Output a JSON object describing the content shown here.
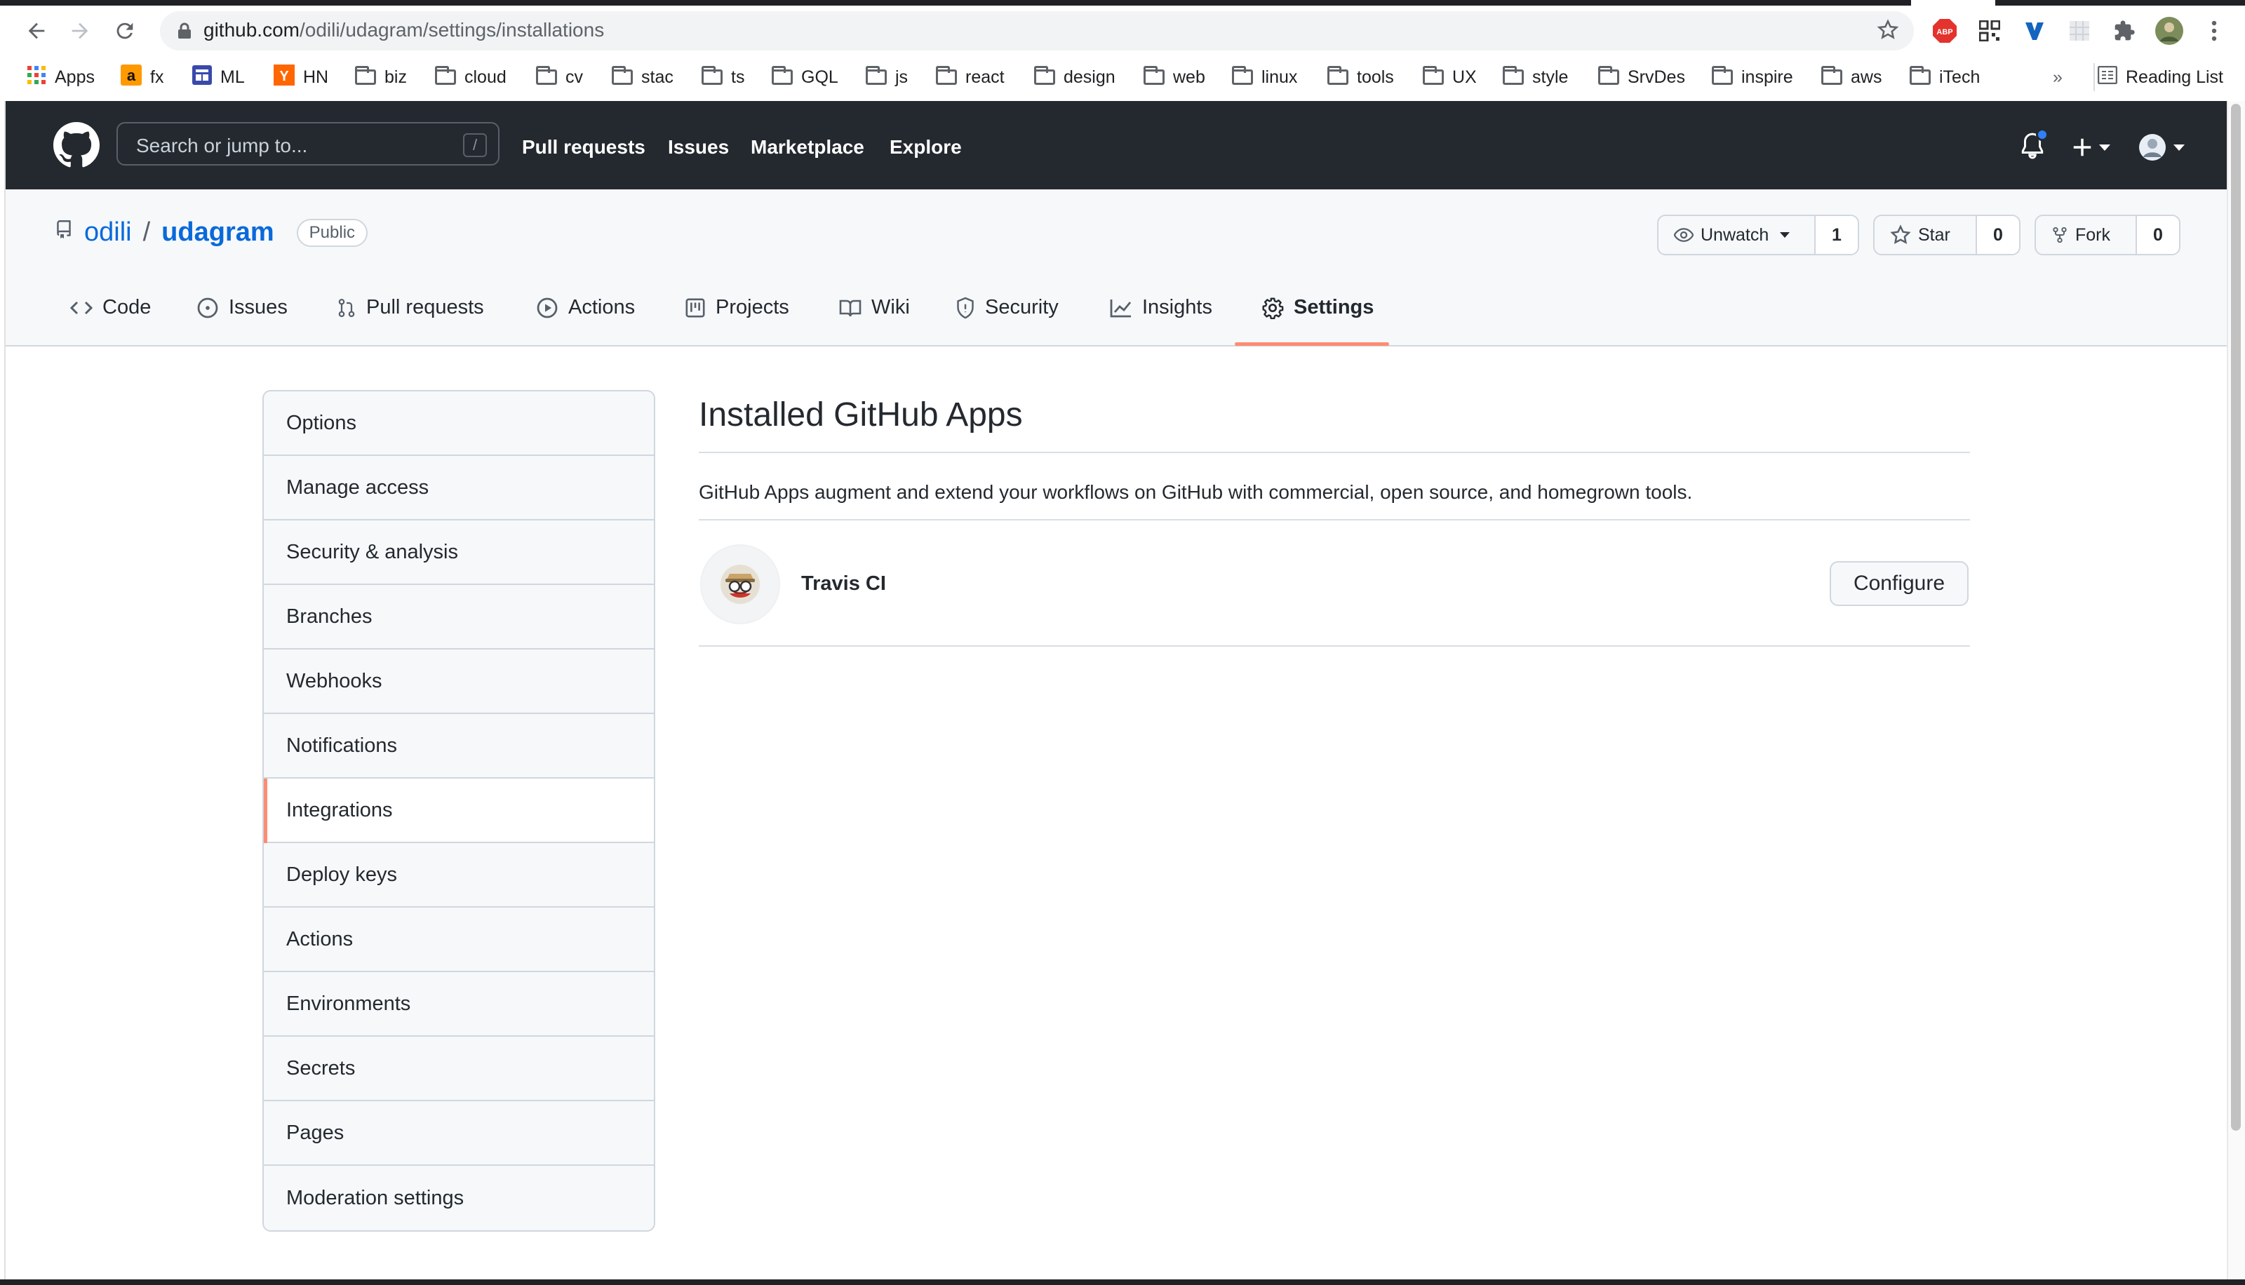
{
  "browser": {
    "url_host": "github.com",
    "url_path": "/odili/udagram/settings/installations",
    "bookmarks": [
      "Apps",
      "fx",
      "ML",
      "HN",
      "biz",
      "cloud",
      "cv",
      "stac",
      "ts",
      "GQL",
      "js",
      "react",
      "design",
      "web",
      "linux",
      "tools",
      "UX",
      "style",
      "SrvDes",
      "inspire",
      "aws",
      "iTech"
    ],
    "overflow": "»",
    "reading_list": "Reading List",
    "extensions": [
      "abp-icon",
      "qr-icon",
      "v-icon",
      "grid-icon",
      "puzzle-icon",
      "profile-icon",
      "menu-icon"
    ]
  },
  "gh_header": {
    "search_placeholder": "Search or jump to...",
    "search_hotkey": "/",
    "nav": [
      "Pull requests",
      "Issues",
      "Marketplace",
      "Explore"
    ]
  },
  "repo": {
    "owner": "odili",
    "separator": "/",
    "name": "udagram",
    "visibility": "Public",
    "watch_label": "Unwatch",
    "watch_count": "1",
    "star_label": "Star",
    "star_count": "0",
    "fork_label": "Fork",
    "fork_count": "0",
    "tabs": [
      "Code",
      "Issues",
      "Pull requests",
      "Actions",
      "Projects",
      "Wiki",
      "Security",
      "Insights",
      "Settings"
    ],
    "active_tab": "Settings"
  },
  "sidebar": {
    "items": [
      "Options",
      "Manage access",
      "Security & analysis",
      "Branches",
      "Webhooks",
      "Notifications",
      "Integrations",
      "Deploy keys",
      "Actions",
      "Environments",
      "Secrets",
      "Pages",
      "Moderation settings"
    ],
    "selected": "Integrations"
  },
  "main": {
    "title": "Installed GitHub Apps",
    "description": "GitHub Apps augment and extend your workflows on GitHub with commercial, open source, and homegrown tools.",
    "apps": [
      {
        "name": "Travis CI",
        "action": "Configure"
      }
    ]
  },
  "colors": {
    "header_bg": "#24292f",
    "link": "#0969da",
    "accent_underline": "#fd8c73"
  }
}
